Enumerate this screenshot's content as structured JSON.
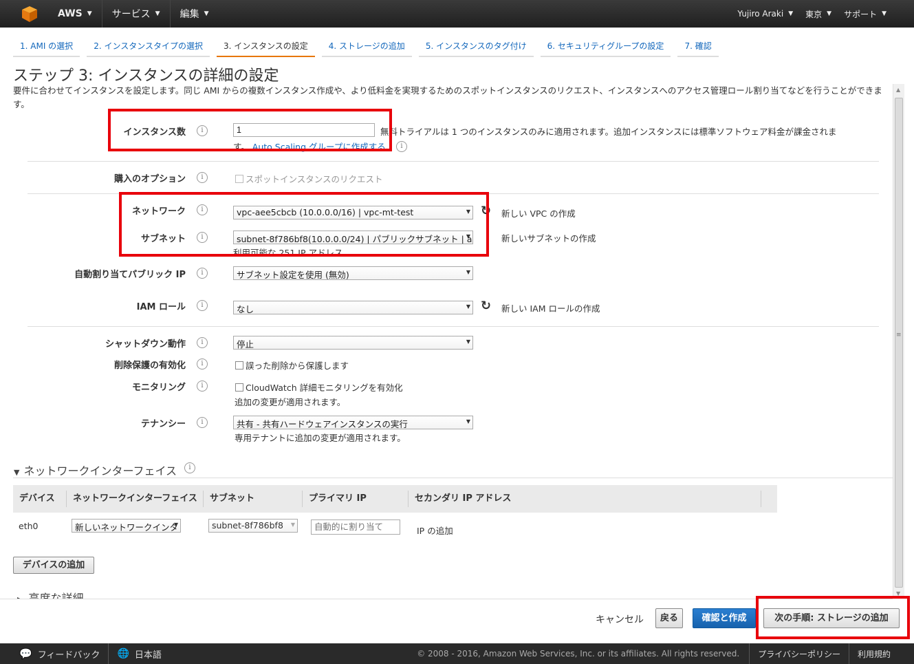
{
  "topnav": {
    "brand": "AWS",
    "services": "サービス",
    "edit": "編集",
    "user": "Yujiro Araki",
    "region": "東京",
    "support": "サポート"
  },
  "tabs": [
    {
      "label": "1. AMI の選択"
    },
    {
      "label": "2. インスタンスタイプの選択"
    },
    {
      "label": "3. インスタンスの設定"
    },
    {
      "label": "4. ストレージの追加"
    },
    {
      "label": "5. インスタンスのタグ付け"
    },
    {
      "label": "6. セキュリティグループの設定"
    },
    {
      "label": "7. 確認"
    }
  ],
  "page": {
    "title": "ステップ 3: インスタンスの詳細の設定",
    "description": "要件に合わせてインスタンスを設定します。同じ AMI からの複数インスタンス作成や、より低料金を実現するためのスポットインスタンスのリクエスト、インスタンスへのアクセス管理ロール割り当てなどを行うことができます。"
  },
  "form": {
    "count": {
      "label": "インスタンス数",
      "value": "1",
      "note1": "無料トライアルは 1 つのインスタンスのみに適用されます。追加インスタンスには標準ソフトウェア料金が課金されま",
      "note2": "す。",
      "link": "Auto Scaling グループに作成する"
    },
    "purchase": {
      "label": "購入のオプション",
      "checkbox": "スポットインスタンスのリクエスト"
    },
    "network": {
      "label": "ネットワーク",
      "value": "vpc-aee5cbcb (10.0.0.0/16) | vpc-mt-test",
      "link": "新しい VPC の作成"
    },
    "subnet": {
      "label": "サブネット",
      "value": "subnet-8f786bf8(10.0.0.0/24) | パブリックサブネット | a",
      "note": "利用可能な 251 IP アドレス",
      "link": "新しいサブネットの作成"
    },
    "public_ip": {
      "label": "自動割り当てパブリック IP",
      "value": "サブネット設定を使用 (無効)"
    },
    "iam": {
      "label": "IAM ロール",
      "value": "なし",
      "link": "新しい IAM ロールの作成"
    },
    "shutdown": {
      "label": "シャットダウン動作",
      "value": "停止"
    },
    "termination": {
      "label": "削除保護の有効化",
      "checkbox": "誤った削除から保護します"
    },
    "monitoring": {
      "label": "モニタリング",
      "checkbox": "CloudWatch 詳細モニタリングを有効化",
      "note": "追加の変更が適用されます。"
    },
    "tenancy": {
      "label": "テナンシー",
      "value": "共有 - 共有ハードウェアインスタンスの実行",
      "note": "専用テナントに追加の変更が適用されます。"
    }
  },
  "network_interfaces": {
    "title": "ネットワークインターフェイス",
    "columns": [
      "デバイス",
      "ネットワークインターフェイス",
      "サブネット",
      "プライマリ IP",
      "セカンダリ IP アドレス"
    ],
    "row": {
      "device": "eth0",
      "interface": "新しいネットワークインタ",
      "subnet": "subnet-8f786bf8",
      "primary_ip_placeholder": "自動的に割り当て",
      "add_ip": "IP の追加"
    },
    "add_device": "デバイスの追加"
  },
  "advanced": "高度な詳細",
  "actions": {
    "cancel": "キャンセル",
    "back": "戻る",
    "review": "確認と作成",
    "next": "次の手順: ストレージの追加"
  },
  "footer": {
    "feedback": "フィードバック",
    "language": "日本語",
    "copyright": "© 2008 - 2016, Amazon Web Services, Inc. or its affiliates. All rights reserved.",
    "privacy": "プライバシーポリシー",
    "terms": "利用規約"
  },
  "colors": {
    "highlight": "#e8000b",
    "primary_button": "#1762ad",
    "active_tab": "#e77600"
  }
}
